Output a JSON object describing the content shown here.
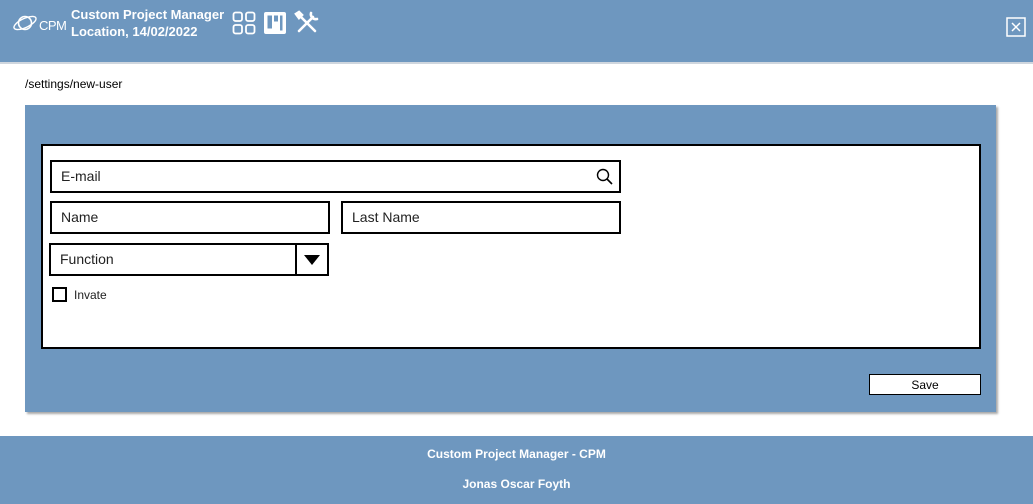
{
  "header": {
    "logo_text": "CPM",
    "app_name": "Custom Project Manager",
    "location_date": "Location, 14/02/2022",
    "icons": [
      "grid-icon",
      "kanban-icon",
      "tools-icon",
      "close-icon"
    ]
  },
  "breadcrumb": "/settings/new-user",
  "form": {
    "email_label": "E-mail",
    "name_label": "Name",
    "last_name_label": "Last Name",
    "function_label": "Function",
    "invite_label": "Invate",
    "invite_checked": false
  },
  "actions": {
    "save_label": "Save"
  },
  "footer": {
    "line1": "Custom Project Manager - CPM",
    "line2": "Jonas Oscar Foyth"
  }
}
